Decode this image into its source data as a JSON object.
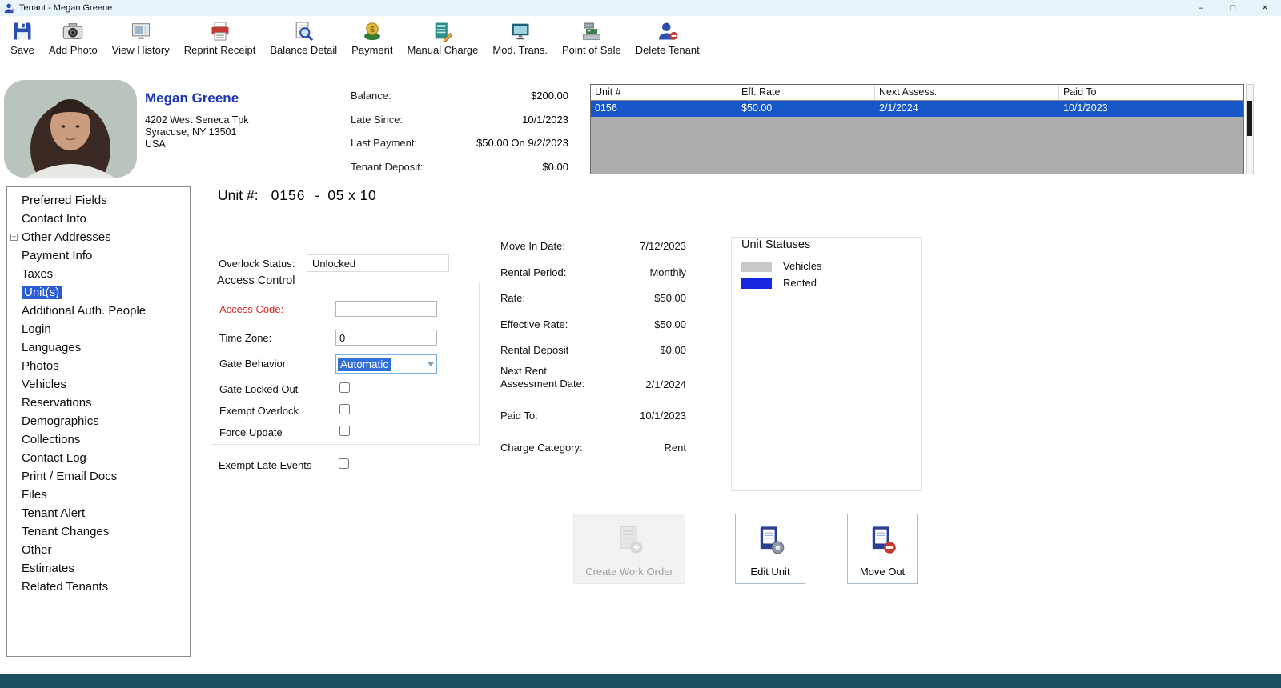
{
  "window": {
    "title": "Tenant - Megan Greene",
    "minimize": "–",
    "maximize": "□",
    "close": "✕"
  },
  "toolbar": {
    "items": [
      {
        "label": "Save",
        "icon": "save-icon"
      },
      {
        "label": "Add Photo",
        "icon": "add-photo-icon"
      },
      {
        "label": "View History",
        "icon": "view-history-icon"
      },
      {
        "label": "Reprint Receipt",
        "icon": "reprint-receipt-icon"
      },
      {
        "label": "Balance Detail",
        "icon": "balance-detail-icon"
      },
      {
        "label": "Payment",
        "icon": "payment-icon"
      },
      {
        "label": "Manual Charge",
        "icon": "manual-charge-icon"
      },
      {
        "label": "Mod. Trans.",
        "icon": "mod-trans-icon"
      },
      {
        "label": "Point of Sale",
        "icon": "point-of-sale-icon"
      },
      {
        "label": "Delete Tenant",
        "icon": "delete-tenant-icon"
      }
    ]
  },
  "tenant": {
    "name": "Megan Greene",
    "address_line1": "4202 West Seneca Tpk",
    "address_line2": "Syracuse, NY 13501",
    "address_line3": "USA",
    "summary": [
      {
        "label": "Balance:",
        "value": "$200.00"
      },
      {
        "label": "Late Since:",
        "value": "10/1/2023"
      },
      {
        "label": "Last Payment:",
        "value": "$50.00 On 9/2/2023"
      },
      {
        "label": "Tenant Deposit:",
        "value": "$0.00"
      }
    ]
  },
  "unit_table": {
    "columns": [
      "Unit #",
      "Eff. Rate",
      "Next Assess.",
      "Paid To"
    ],
    "rows": [
      {
        "cells": [
          "0156",
          "$50.00",
          "2/1/2024",
          "10/1/2023"
        ],
        "selected": true
      }
    ]
  },
  "sidebar": {
    "items": [
      "Preferred Fields",
      "Contact Info",
      "Other Addresses",
      "Payment Info",
      "Taxes",
      "Unit(s)",
      "Additional Auth. People",
      "Login",
      "Languages",
      "Photos",
      "Vehicles",
      "Reservations",
      "Demographics",
      "Collections",
      "Contact Log",
      "Print / Email Docs",
      "Files",
      "Tenant Alert",
      "Tenant Changes",
      "Other",
      "Estimates",
      "Related Tenants"
    ],
    "selected_item": "Unit(s)"
  },
  "unit_heading": {
    "label": "Unit #:",
    "number": "0156",
    "separator": "-",
    "size": "05 x 10"
  },
  "form": {
    "overlock_label": "Overlock Status:",
    "overlock_value": "Unlocked",
    "access_control_title": "Access Control",
    "access_code_label": "Access Code:",
    "access_code_value": "",
    "time_zone_label": "Time Zone:",
    "time_zone_value": "0",
    "gate_behavior_label": "Gate Behavior",
    "gate_behavior_value": "Automatic",
    "checkbox_gate_locked_out": "Gate Locked Out",
    "checkbox_exempt_overlock": "Exempt Overlock",
    "checkbox_force_update": "Force Update",
    "checkbox_exempt_late_events": "Exempt Late Events"
  },
  "details": {
    "rows": [
      {
        "label": "Move In Date:",
        "value": "7/12/2023"
      },
      {
        "label": "Rental Period:",
        "value": "Monthly"
      },
      {
        "label": "Rate:",
        "value": "$50.00"
      },
      {
        "label": "Effective Rate:",
        "value": "$50.00"
      },
      {
        "label": "Rental Deposit",
        "value": "$0.00"
      },
      {
        "label": "Next Rent\nAssessment Date:",
        "value": "2/1/2024"
      },
      {
        "label": "Paid To:",
        "value": "10/1/2023"
      },
      {
        "label": "Charge Category:",
        "value": "Rent"
      }
    ]
  },
  "unit_statuses": {
    "title": "Unit Statuses",
    "items": [
      {
        "label": "Vehicles",
        "color": "#c8c8c8"
      },
      {
        "label": "Rented",
        "color": "#1726df"
      }
    ]
  },
  "actions": [
    {
      "label": "Create Work Order",
      "enabled": false
    },
    {
      "label": "Edit Unit",
      "enabled": true
    },
    {
      "label": "Move Out",
      "enabled": true
    }
  ],
  "colors": {
    "selected_blue": "#1857c8",
    "sidebar_selected": "#2a5cd7",
    "name_blue": "#1f35b5",
    "access_code_red": "#e02b20",
    "bottom_bar": "#1b5060"
  }
}
